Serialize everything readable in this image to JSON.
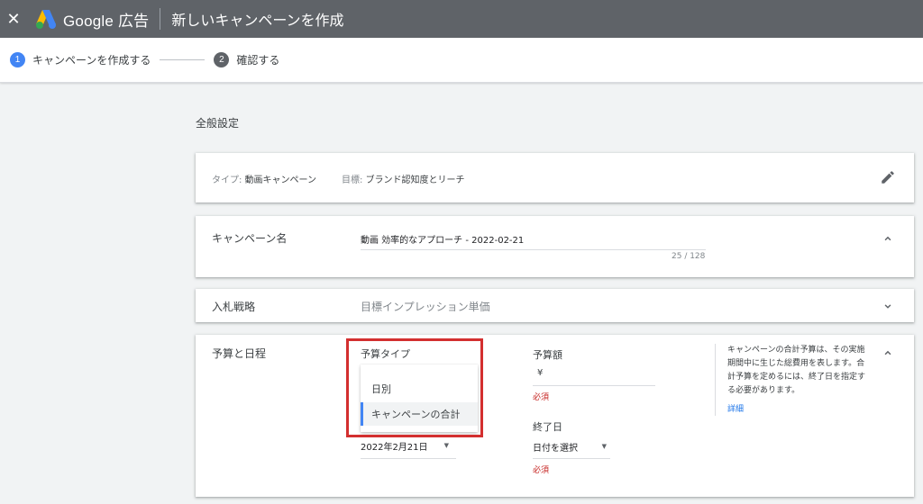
{
  "header": {
    "close_label": "✕",
    "brand": "Google 広告",
    "title": "新しいキャンペーンを作成"
  },
  "stepper": {
    "steps": [
      {
        "number": "1",
        "label": "キャンペーンを作成する",
        "active": true
      },
      {
        "number": "2",
        "label": "確認する",
        "active": false
      }
    ]
  },
  "section": {
    "heading": "全般設定"
  },
  "type_card": {
    "type_prefix": "タイプ: ",
    "type_value": "動画キャンペーン",
    "goal_prefix": "目標: ",
    "goal_value": "ブランド認知度とリーチ",
    "edit_icon": "pencil-icon"
  },
  "name_card": {
    "label": "キャンペーン名",
    "value": "動画 効率的なアプローチ - 2022-02-21",
    "char_count": "25 / 128"
  },
  "bid_card": {
    "label": "入札戦略",
    "value": "目標インプレッション単価"
  },
  "budget_card": {
    "label": "予算と日程",
    "budget_type_label": "予算タイプ",
    "options": [
      "日別",
      "キャンペーンの合計"
    ],
    "selected_option": "キャンペーンの合計",
    "start_date": "2022年2月21日",
    "amount_label": "予算額",
    "currency": "¥",
    "required_1": "必須",
    "end_label": "終了日",
    "end_date": "日付を選択",
    "required_2": "必須",
    "help_text": "キャンペーンの合計予算は、その実施期間中に生じた総費用を表します。合計予算を定めるには、終了日を指定する必要があります。",
    "help_link": "詳細"
  },
  "colors": {
    "topbar": "#5f6368",
    "accent_blue": "#4285f4",
    "highlight_red": "#d32f2f",
    "required_red": "#c5221f",
    "link_blue": "#1a73e8"
  }
}
